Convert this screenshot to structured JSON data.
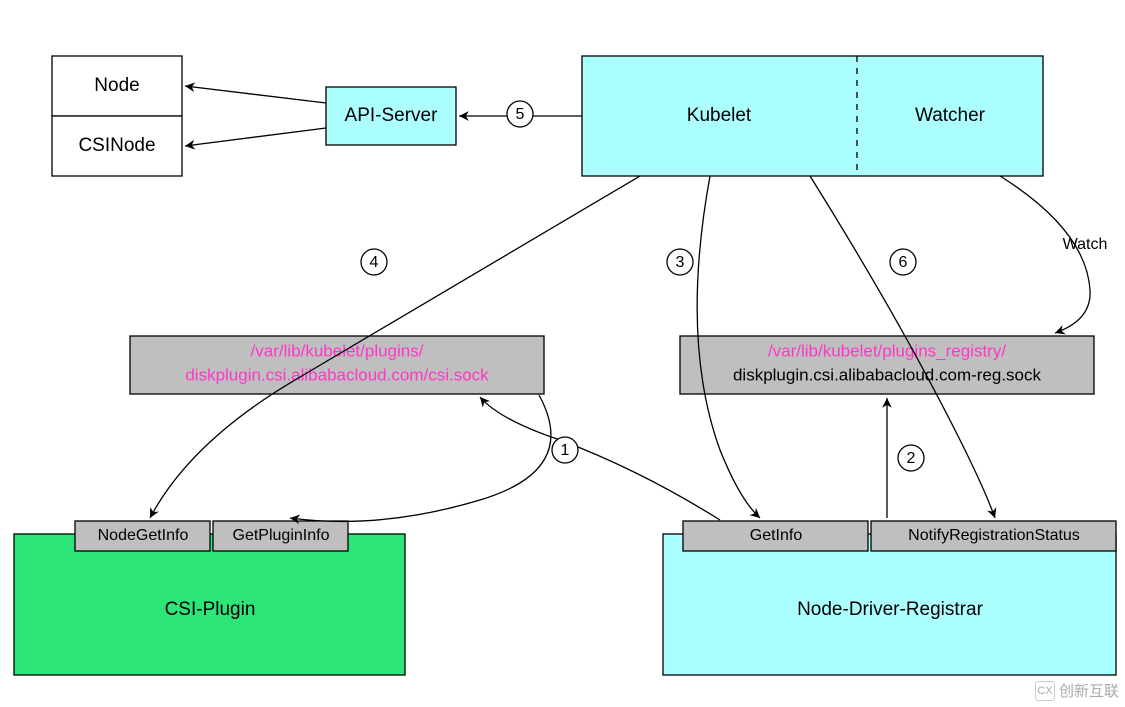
{
  "boxes": {
    "node": "Node",
    "csinode": "CSINode",
    "apiserver": "API-Server",
    "kubelet": "Kubelet",
    "watcher": "Watcher",
    "csi_plugin": "CSI-Plugin",
    "csi_nodegetinfo": "NodeGetInfo",
    "csi_getplugininfo": "GetPluginInfo",
    "ndr": "Node-Driver-Registrar",
    "ndr_getinfo": "GetInfo",
    "ndr_notify": "NotifyRegistrationStatus",
    "sock_left_line1": "/var/lib/kubelet/plugins/",
    "sock_left_line2": "diskplugin.csi.alibabacloud.com/csi.sock",
    "sock_right_line1": "/var/lib/kubelet/plugins_registry/",
    "sock_right_line2": "diskplugin.csi.alibabacloud.com-reg.sock"
  },
  "edge_labels": {
    "step1": "1",
    "step2": "2",
    "step3": "3",
    "step4": "4",
    "step5": "5",
    "step6": "6",
    "watch": "Watch"
  },
  "watermark": {
    "text": "创新互联",
    "icon": "CX"
  },
  "diagram_description": "CSI plugin registration flow between Kubelet Watcher, Node-Driver-Registrar, CSI-Plugin, API-Server, and Node/CSINode resources."
}
